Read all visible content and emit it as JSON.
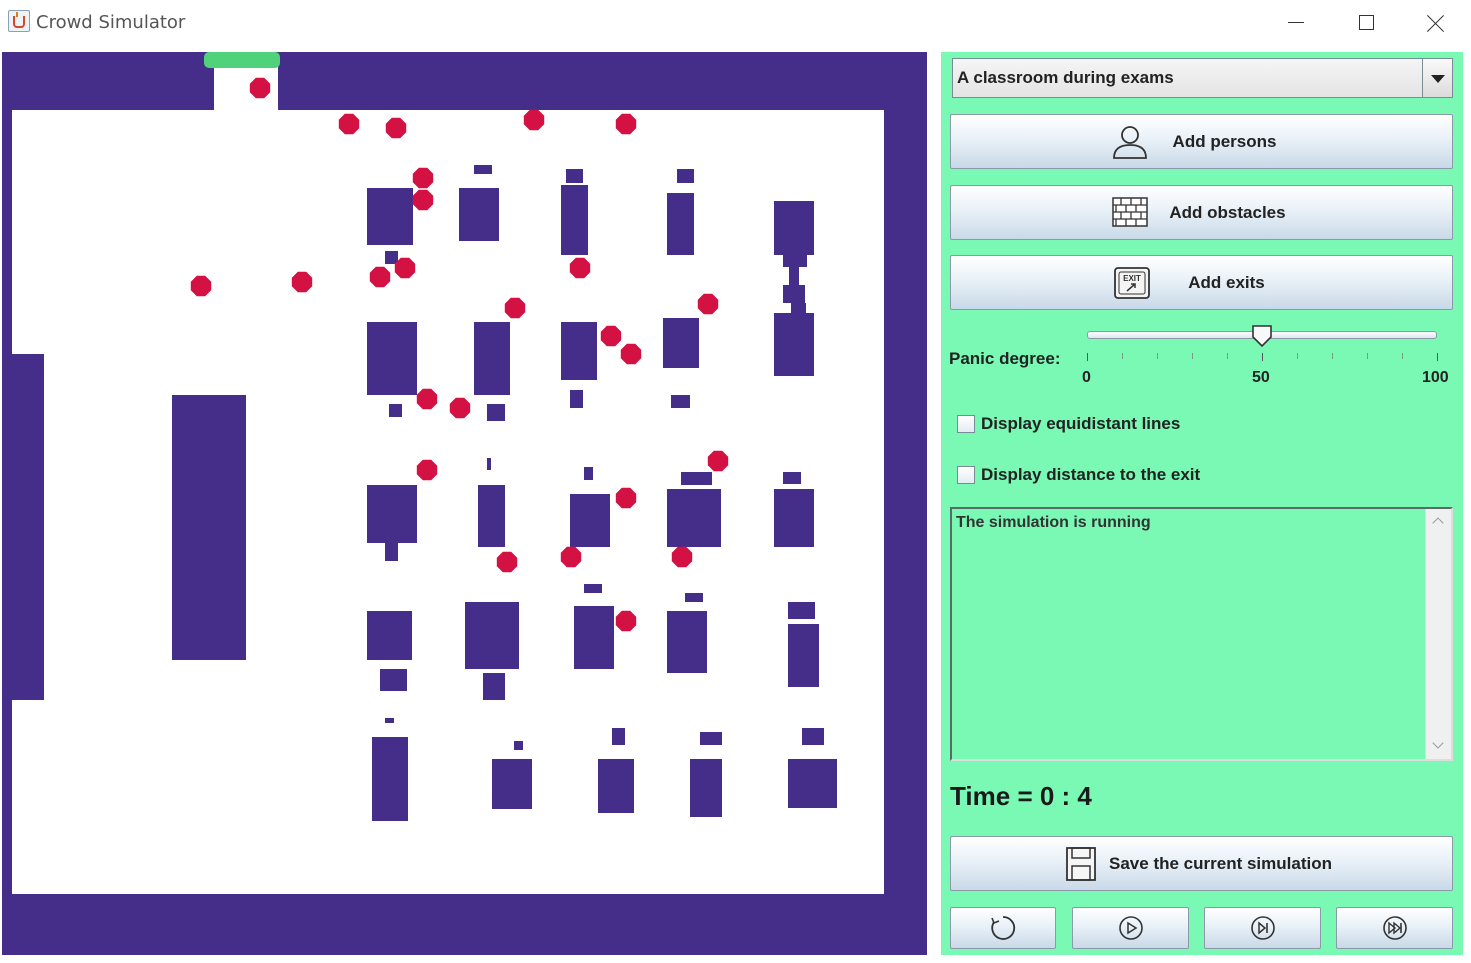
{
  "window": {
    "title": "Crowd Simulator",
    "icon": "java-cup-icon",
    "controls": [
      "minimize-icon",
      "maximize-icon",
      "close-icon"
    ]
  },
  "colors": {
    "wall": "#452d8a",
    "floor": "#ffffff",
    "person": "#d41143",
    "exit": "#4fd27a",
    "panel": "#79f9b4"
  },
  "panel": {
    "scenario": {
      "selected": "A classroom during exams"
    },
    "buttons": {
      "add_persons": "Add persons",
      "add_obstacles": "Add obstacles",
      "add_exits": "Add exits",
      "save": "Save the current simulation"
    },
    "panic": {
      "label": "Panic degree:",
      "value": 50,
      "min": 0,
      "max": 100,
      "tick_labels": [
        "0",
        "50",
        "100"
      ]
    },
    "checkboxes": {
      "equidistant": {
        "label": "Display equidistant lines",
        "checked": false
      },
      "distance": {
        "label": "Display distance to the exit",
        "checked": false
      }
    },
    "log": {
      "text": "The simulation is running"
    },
    "time": "Time = 0 : 4",
    "playback": {
      "reset_icon": "reset-icon",
      "play_icon": "play-icon",
      "step_icon": "step-forward-icon",
      "fast_icon": "fast-forward-icon"
    }
  }
}
